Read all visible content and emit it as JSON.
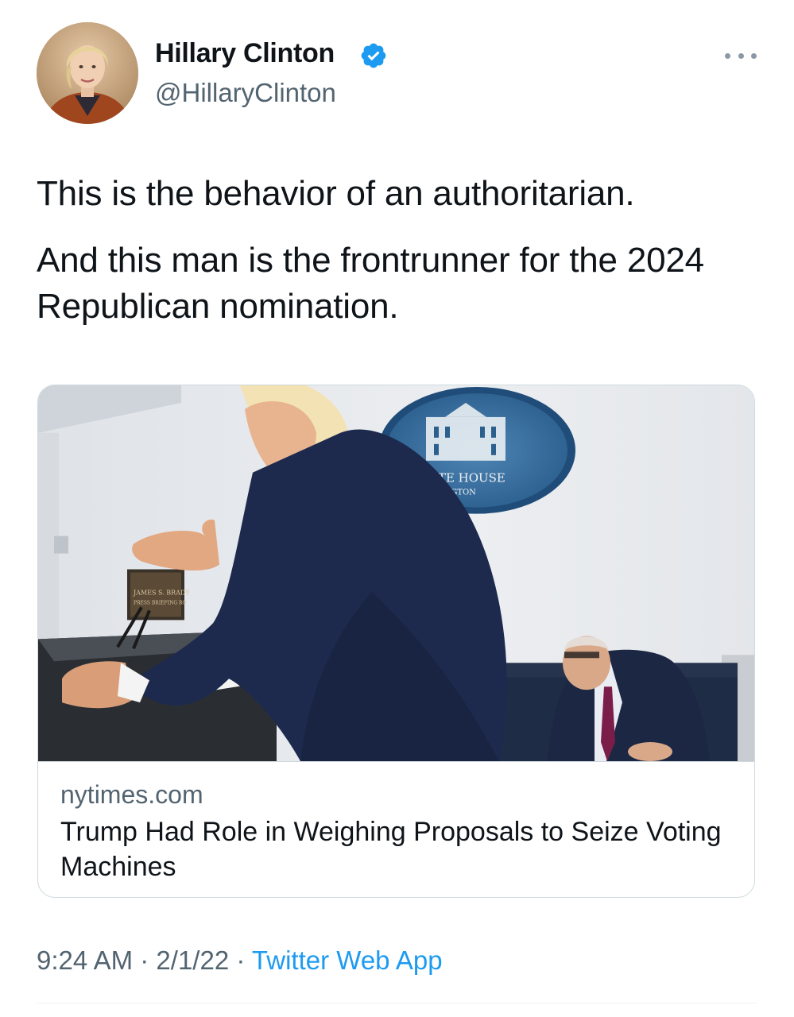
{
  "tweet": {
    "author": {
      "name": "Hillary Clinton",
      "handle": "@HillaryClinton",
      "verified": true
    },
    "text": [
      "This is the behavior of an authoritarian.",
      "And this man is the frontrunner for the 2024 Republican nomination."
    ],
    "card": {
      "image_seal_text_1": "HITE HOUSE",
      "image_seal_text_2": "HINGTON",
      "image_plaque_text_1": "JAMES S. BRADY",
      "image_plaque_text_2": "PRESS BRIEFING RO",
      "domain": "nytimes.com",
      "title": "Trump Had Role in Weighing Proposals to Seize Voting Machines"
    },
    "meta": {
      "time": "9:24 AM",
      "separator": "·",
      "date": "2/1/22",
      "source": "Twitter Web App"
    }
  },
  "colors": {
    "text_primary": "#0f1419",
    "text_secondary": "#536471",
    "accent": "#1d9bf0",
    "border": "#cfd9de"
  },
  "icons": {
    "verified": "verified-badge-icon",
    "more": "more-options-icon"
  }
}
